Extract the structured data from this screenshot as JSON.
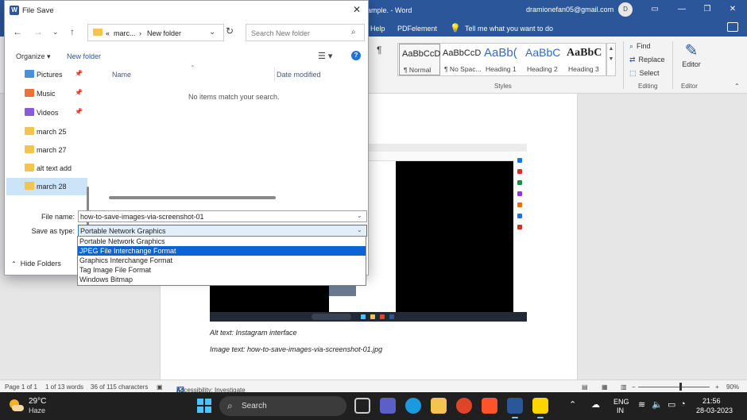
{
  "word": {
    "doc_title": "ample. - Word",
    "account_email": "dramionefan05@gmail.com",
    "avatar_initial": "D",
    "tabs": [
      {
        "label": "Help"
      },
      {
        "label": "PDFelement"
      }
    ],
    "tell_me": "Tell me what you want to do",
    "styles": [
      {
        "sample": "AaBbCcD",
        "name": "¶ Normal"
      },
      {
        "sample": "AaBbCcD",
        "name": "¶ No Spac..."
      },
      {
        "sample": "AaBb(",
        "name": "Heading 1"
      },
      {
        "sample": "AaBbC",
        "name": "Heading 2"
      },
      {
        "sample": "AaBbC",
        "name": "Heading 3"
      }
    ],
    "styles_group": "Styles",
    "editing": {
      "find": "Find",
      "replace": "Replace",
      "select": "Select",
      "group": "Editing"
    },
    "editor": {
      "label": "Editor",
      "group": "Editor"
    },
    "page": {
      "alt_text": "Alt text: Instagram interface",
      "image_text": "Image text: how-to-save-images-via-screenshot-01.jpg"
    },
    "status": {
      "page": "Page 1 of 1",
      "words": "1 of 13 words",
      "chars": "36 of 115 characters",
      "accessibility": "Accessibility: Investigate",
      "zoom": "90%",
      "zoom_level": 0.9
    }
  },
  "dialog": {
    "title": "File Save",
    "address": {
      "ellipsis": "«",
      "parent": "marc...",
      "sep": "›",
      "current": "New folder"
    },
    "search_placeholder": "Search New folder",
    "organize": "Organize ▾",
    "new_folder": "New folder",
    "nav_items": [
      {
        "label": "Pictures",
        "pinned": true,
        "icon": "pictures-icon"
      },
      {
        "label": "Music",
        "pinned": true,
        "icon": "music-icon"
      },
      {
        "label": "Videos",
        "pinned": true,
        "icon": "videos-icon"
      },
      {
        "label": "march 25",
        "pinned": false,
        "icon": "folder-icon"
      },
      {
        "label": "march 27",
        "pinned": false,
        "icon": "folder-icon"
      },
      {
        "label": "alt text add",
        "pinned": false,
        "icon": "folder-icon"
      },
      {
        "label": "march 28",
        "pinned": false,
        "icon": "folder-icon",
        "selected": true
      }
    ],
    "columns": {
      "name": "Name",
      "date": "Date modified"
    },
    "empty_message": "No items match your search.",
    "file_name_label": "File name:",
    "file_name_value": "how-to-save-images-via-screenshot-01",
    "save_type_label": "Save as type:",
    "save_type_value": "Portable Network Graphics",
    "type_options": [
      "Portable Network Graphics",
      "JPEG File Interchange Format",
      "Graphics Interchange Format",
      "Tag Image File Format",
      "Windows Bitmap"
    ],
    "highlighted_option": "JPEG File Interchange Format",
    "hide_folders": "Hide Folders"
  },
  "taskbar": {
    "weather_temp": "29°C",
    "weather_desc": "Haze",
    "search_label": "Search",
    "lang_1": "ENG",
    "lang_2": "IN",
    "time": "21:56",
    "date": "28-03-2023"
  },
  "colors": {
    "word_blue": "#2b579a",
    "select_blue": "#0a64d6",
    "taskbar": "#202020"
  }
}
